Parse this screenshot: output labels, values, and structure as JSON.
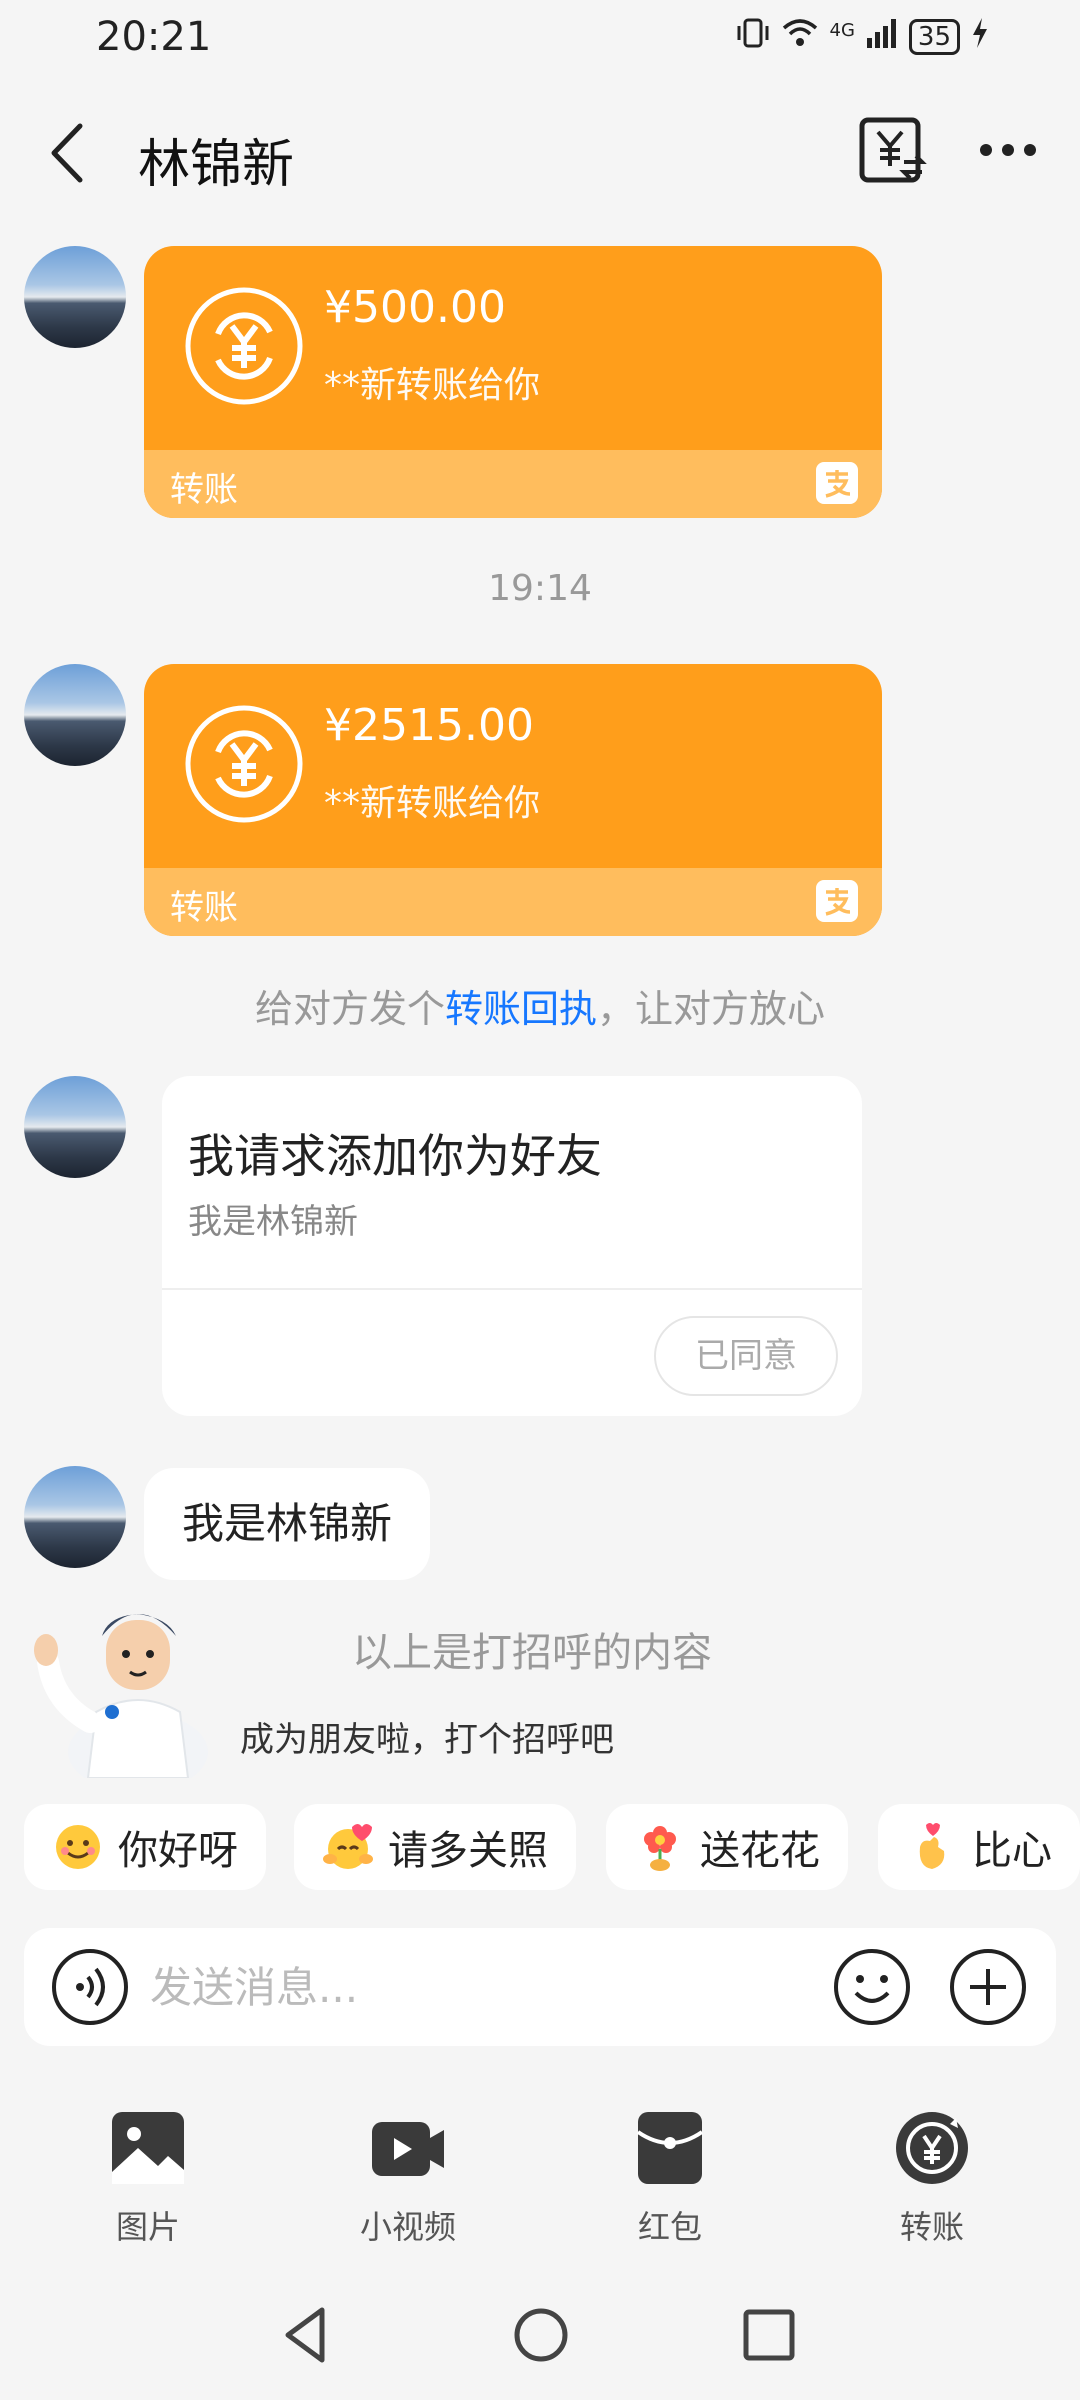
{
  "status_bar": {
    "time": "20:21",
    "signal": "4G",
    "battery": "35"
  },
  "header": {
    "title": "林锦新"
  },
  "messages": {
    "transfer1": {
      "amount": "¥500.00",
      "desc": "**新转账给你",
      "label": "转账"
    },
    "time_divider": "19:14",
    "transfer2": {
      "amount": "¥2515.00",
      "desc": "**新转账给你",
      "label": "转账"
    },
    "receipt_tip": {
      "prefix": "给对方发个",
      "link": "转账回执",
      "suffix": "，让对方放心"
    },
    "friend_request": {
      "title": "我请求添加你为好友",
      "subtitle": "我是林锦新",
      "status": "已同意"
    },
    "text_message": "我是林锦新",
    "greeting_hint": "以上是打招呼的内容",
    "greeting_sub": "成为朋友啦，打个招呼吧"
  },
  "quick_replies": [
    {
      "label": "你好呀",
      "emoji": "smile-face-icon"
    },
    {
      "label": "请多关照",
      "emoji": "hug-face-icon"
    },
    {
      "label": "送花花",
      "emoji": "flower-icon"
    },
    {
      "label": "比心",
      "emoji": "finger-heart-icon"
    }
  ],
  "input": {
    "placeholder": "发送消息..."
  },
  "tools": [
    {
      "label": "图片",
      "icon": "image-icon"
    },
    {
      "label": "小视频",
      "icon": "video-icon"
    },
    {
      "label": "红包",
      "icon": "red-packet-icon"
    },
    {
      "label": "转账",
      "icon": "transfer-icon"
    }
  ],
  "colors": {
    "transfer_orange": "#ff9e1b",
    "transfer_footer": "#ffbd5d",
    "link_blue": "#1677ff",
    "background": "#f5f5f5"
  }
}
